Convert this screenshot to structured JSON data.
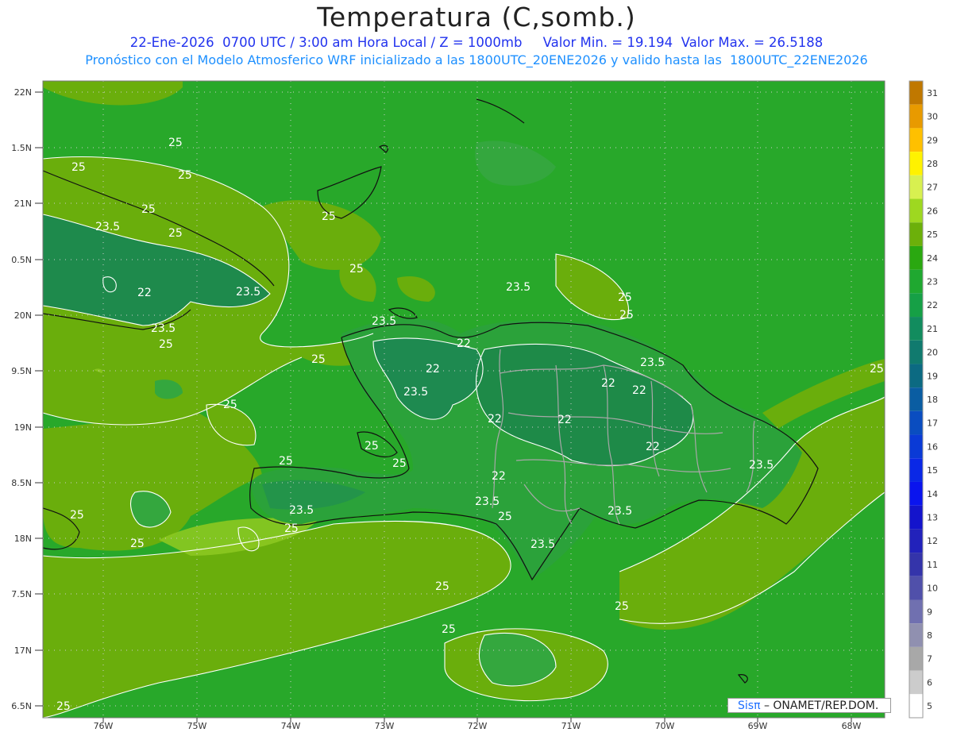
{
  "header": {
    "title": "Temperatura (C,somb.)",
    "line1": "22-Ene-2026  0700 UTC / 3:00 am Hora Local / Z = 1000mb     Valor Min. = 19.194  Valor Max. = 26.5188",
    "line2": "Pronóstico con el Modelo Atmosferico WRF inicializado a las 1800UTC_20ENE2026 y valido hasta las  1800UTC_22ENE2026"
  },
  "axes": {
    "lat_labels": [
      "22N",
      "1.5N",
      "21N",
      "0.5N",
      "20N",
      "9.5N",
      "19N",
      "8.5N",
      "18N",
      "7.5N",
      "17N",
      "6.5N"
    ],
    "lon_labels": [
      "76W",
      "75W",
      "74W",
      "73W",
      "72W",
      "71W",
      "70W",
      "69W",
      "68W"
    ]
  },
  "colorbar": {
    "labels": [
      "31",
      "30",
      "29",
      "28",
      "27",
      "26",
      "25",
      "24",
      "23",
      "22",
      "21",
      "20",
      "19",
      "18",
      "17",
      "16",
      "15",
      "14",
      "13",
      "12",
      "11",
      "10",
      "9",
      "8",
      "7",
      "6",
      "5"
    ],
    "colors": [
      "#c07800",
      "#e89a00",
      "#ffc000",
      "#fff200",
      "#d8f050",
      "#9ed820",
      "#6cb00a",
      "#2aa810",
      "#1fa830",
      "#16a046",
      "#128c5e",
      "#107a6e",
      "#0c6a82",
      "#0a5da2",
      "#0a4dc0",
      "#0a3ad6",
      "#0a28e6",
      "#0a14ee",
      "#1414cc",
      "#2222bb",
      "#3434aa",
      "#5050aa",
      "#7070b0",
      "#9090b0",
      "#a8a8a8",
      "#cccccc",
      "#ffffff"
    ]
  },
  "contour_labels": [
    {
      "text": "25"
    },
    {
      "text": "25"
    },
    {
      "text": "25"
    },
    {
      "text": "25"
    },
    {
      "text": "25"
    },
    {
      "text": "25"
    },
    {
      "text": "23.5"
    },
    {
      "text": "23.5"
    },
    {
      "text": "22"
    },
    {
      "text": "23.5"
    },
    {
      "text": "25"
    },
    {
      "text": "25"
    },
    {
      "text": "23.5"
    },
    {
      "text": "22"
    },
    {
      "text": "23.5"
    },
    {
      "text": "25"
    },
    {
      "text": "23.5"
    },
    {
      "text": "25"
    },
    {
      "text": "23.5"
    },
    {
      "text": "22"
    },
    {
      "text": "22"
    },
    {
      "text": "22"
    },
    {
      "text": "22"
    },
    {
      "text": "23.5"
    },
    {
      "text": "22"
    },
    {
      "text": "22"
    },
    {
      "text": "22"
    },
    {
      "text": "23.5"
    },
    {
      "text": "23.5"
    },
    {
      "text": "23.5"
    },
    {
      "text": "25"
    },
    {
      "text": "25"
    },
    {
      "text": "25"
    },
    {
      "text": "25"
    },
    {
      "text": "25"
    },
    {
      "text": "25"
    },
    {
      "text": "25"
    },
    {
      "text": "25"
    },
    {
      "text": "23.5"
    },
    {
      "text": "25"
    },
    {
      "text": "25"
    },
    {
      "text": "25"
    },
    {
      "text": "25"
    }
  ],
  "credit": {
    "sis": "Sisπ",
    "text": "– ONAMET/REP.DOM."
  },
  "colors": {
    "sea_base": "#28a82a",
    "warm_band": "#6aae0c",
    "cool_interior": "#1e8a48",
    "title_blue": "#2233ee",
    "subtitle_blue": "#1e90ff"
  }
}
